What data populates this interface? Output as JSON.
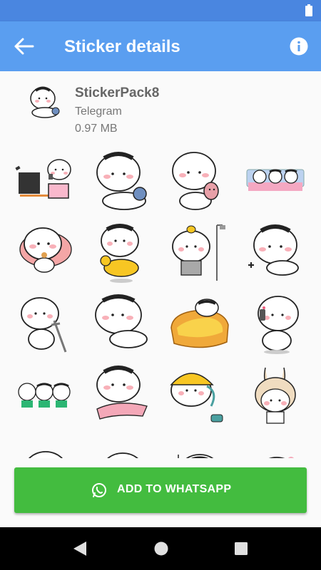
{
  "app_bar": {
    "title": "Sticker details",
    "back_icon": "arrow-left-icon",
    "info_icon": "info-icon",
    "color": "#5a9ef0"
  },
  "status_bar": {
    "color": "#4a86e0",
    "battery_icon": "battery-icon"
  },
  "pack": {
    "name": "StickerPack8",
    "publisher": "Telegram",
    "size": "0.97 MB"
  },
  "stickers": [
    "sticker-tv-sofa",
    "sticker-sitting-backpack",
    "sticker-pig-toy",
    "sticker-sleeping-three",
    "sticker-eating-lying",
    "sticker-duck-float",
    "sticker-shower-bird",
    "sticker-lying-wave",
    "sticker-crutch",
    "sticker-lying-pose",
    "sticker-toast-bed",
    "sticker-phone-call",
    "sticker-three-friends",
    "sticker-pillow-hug",
    "sticker-hardhat-phone",
    "sticker-bunny-hat",
    "sticker-row5-1",
    "sticker-row5-2",
    "sticker-row5-3",
    "sticker-row5-4"
  ],
  "add_button": {
    "label": "ADD TO WHATSAPP",
    "icon": "whatsapp-icon",
    "color": "#43bc3f"
  },
  "nav": {
    "back_icon": "nav-back-icon",
    "home_icon": "nav-home-icon",
    "recent_icon": "nav-recents-icon"
  }
}
